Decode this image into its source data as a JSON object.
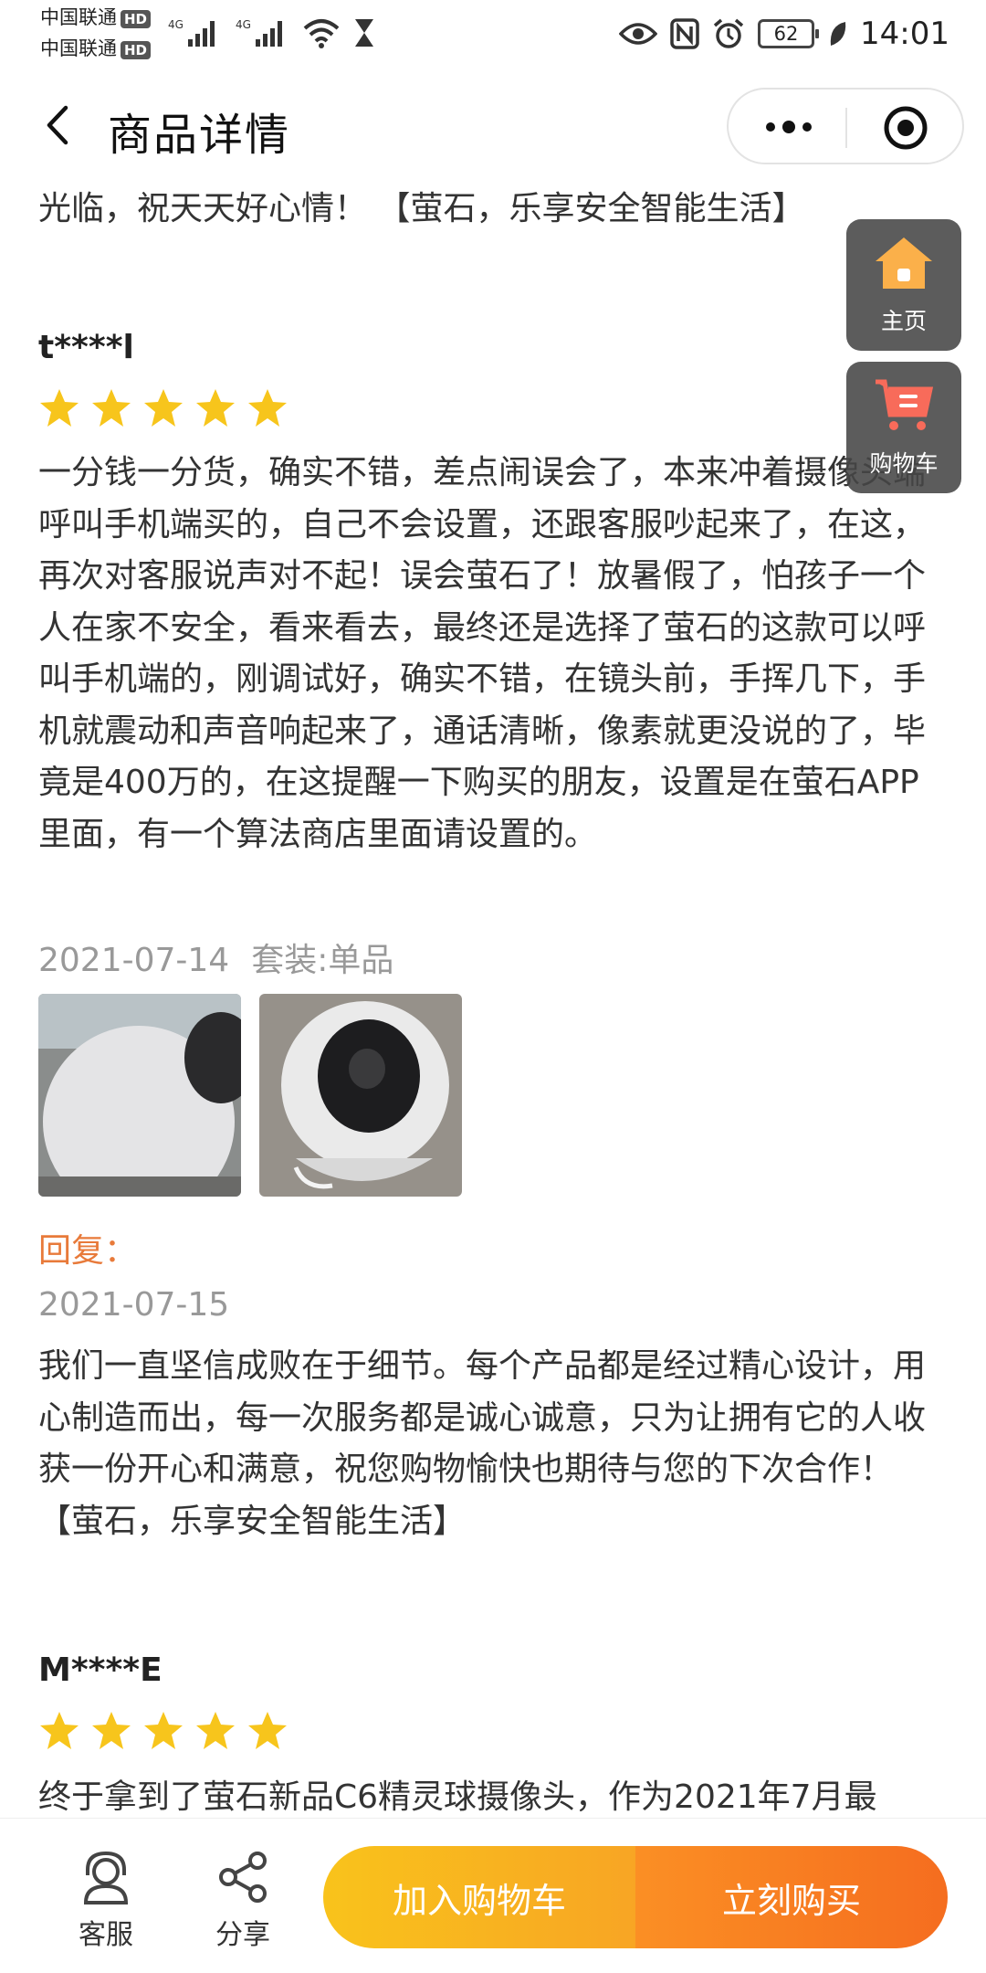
{
  "status_bar": {
    "carrier_1": "中国联通",
    "carrier_2": "中国联通",
    "hd_badge": "HD",
    "network_1": "4G",
    "network_2": "4G",
    "battery_level": "62",
    "time": "14:01"
  },
  "header": {
    "title": "商品详情"
  },
  "floating": {
    "home_label": "主页",
    "cart_label": "购物车"
  },
  "previous_reply_tail": "光临，祝天天好心情！ 【萤石，乐享安全智能生活】",
  "reviews": [
    {
      "user": "t****l",
      "rating": 5,
      "text": "一分钱一分货，确实不错，差点闹误会了，本来冲着摄像头端呼叫手机端买的，自己不会设置，还跟客服吵起来了，在这，再次对客服说声对不起！误会萤石了！放暑假了，怕孩子一个人在家不安全，看来看去，最终还是选择了萤石的这款可以呼叫手机端的，刚调试好，确实不错，在镜头前，手挥几下，手机就震动和声音响起来了，通话清晰，像素就更没说的了，毕竟是400万的，在这提醒一下购买的朋友，设置是在萤石APP里面，有一个算法商店里面请设置的。",
      "date": "2021-07-14",
      "variant": "套装:单品",
      "reply_label": "回复：",
      "reply_date": "2021-07-15",
      "reply_text": "我们一直坚信成败在于细节。每个产品都是经过精心设计，用心制造而出，每一次服务都是诚心诚意，只为让拥有它的人收获一份开心和满意，祝您购物愉快也期待与您的下次合作！ 【萤石，乐享安全智能生活】"
    },
    {
      "user": "M****E",
      "rating": 5,
      "text": "终于拿到了萤石新品C6精灵球摄像头，作为2021年7月最"
    }
  ],
  "bottom_bar": {
    "service_label": "客服",
    "share_label": "分享",
    "add_cart_label": "加入购物车",
    "buy_now_label": "立刻购买"
  },
  "colors": {
    "star": "#f7c51c",
    "reply_label": "#e87a3a",
    "add_cart_gradient": [
      "#f9c31b",
      "#f8a524"
    ],
    "buy_now_gradient": [
      "#fb8f24",
      "#f56d1f"
    ]
  }
}
